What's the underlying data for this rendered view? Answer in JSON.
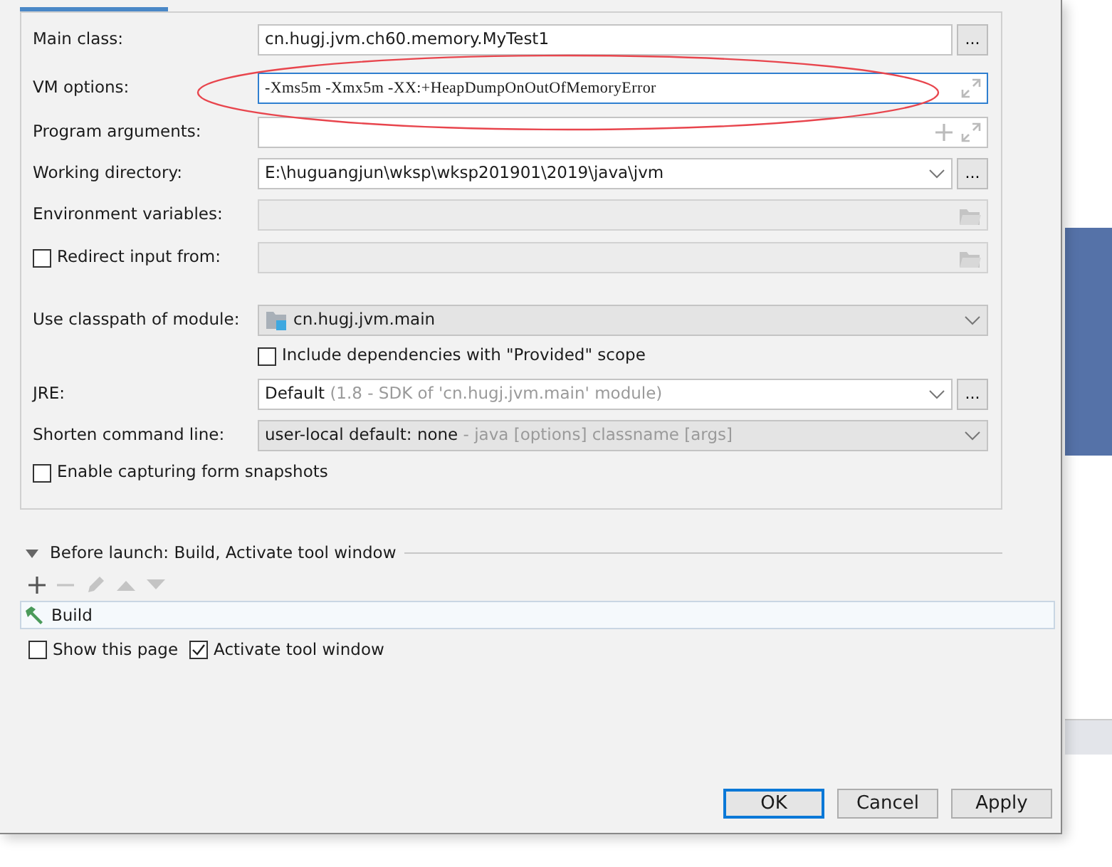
{
  "tab": {
    "selected": true
  },
  "fields": [
    {
      "kind": "text",
      "label": "Main class:",
      "value": "cn.hugj.jvm.ch60.memory.MyTest1",
      "browse": "...",
      "focused": false
    },
    {
      "kind": "expand",
      "label": "VM options:",
      "value": "-Xms5m -Xmx5m -XX:+HeapDumpOnOutOfMemoryError",
      "focused": true
    },
    {
      "kind": "args",
      "label": "Program arguments:",
      "focused": false
    },
    {
      "kind": "combo",
      "label": "Working directory:",
      "value": "E:\\huguangjun\\wksp\\wksp201901\\2019\\java\\jvm",
      "browse": "...",
      "focused": false
    },
    {
      "kind": "folder",
      "label": "Environment variables:",
      "focused": false
    },
    {
      "kind": "folder",
      "label": "Redirect input from:",
      "checked": false,
      "focused": false
    }
  ],
  "module": {
    "label": "Use classpath of module:",
    "value": "cn.hugj.jvm.main"
  },
  "include": {
    "label": "Include dependencies with \"Provided\" scope",
    "checked": false
  },
  "jre": {
    "label": "JRE:",
    "value": "Default",
    "hint": "(1.8 - SDK of 'cn.hugj.jvm.main' module)",
    "browse": "..."
  },
  "shorten": {
    "label": "Shorten command line:",
    "value": "user-local default: none",
    "hint": "- java [options] classname [args]"
  },
  "snapshots": {
    "label": "Enable capturing form snapshots",
    "checked": false
  },
  "before_launch": {
    "title": "Before launch: Build, Activate tool window",
    "expanded": true
  },
  "toolbar": [
    {
      "kind": "add",
      "disabled": false
    },
    {
      "kind": "remove",
      "disabled": true
    },
    {
      "kind": "edit",
      "disabled": true
    },
    {
      "kind": "up",
      "disabled": true
    },
    {
      "kind": "down",
      "disabled": true
    }
  ],
  "tasks": [
    {
      "label": "Build"
    }
  ],
  "options": [
    {
      "label": "Show this page",
      "checked": false
    },
    {
      "label": "Activate tool window",
      "checked": true
    }
  ],
  "buttons": [
    {
      "label": "OK",
      "default": true
    },
    {
      "label": "Cancel",
      "default": false
    },
    {
      "label": "Apply",
      "default": false
    }
  ]
}
